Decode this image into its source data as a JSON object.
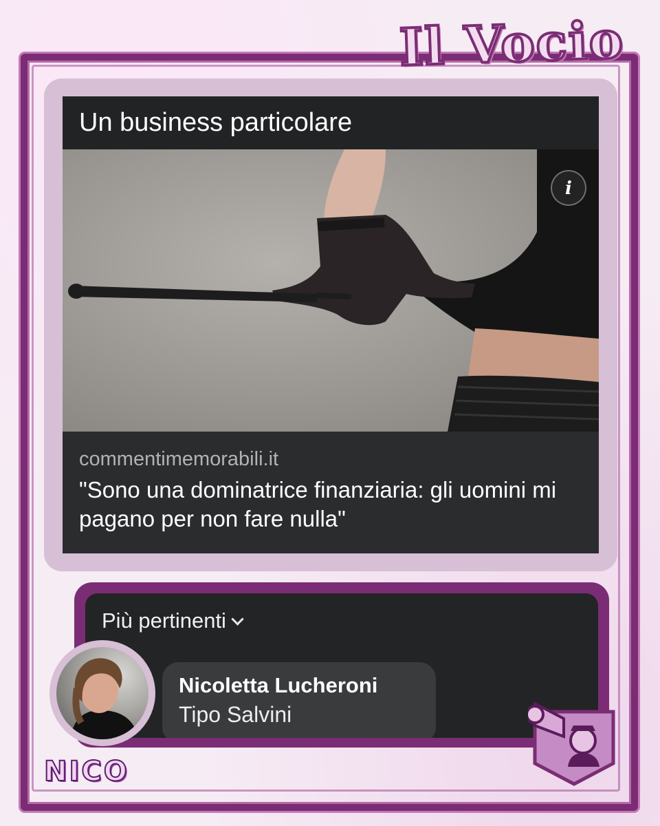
{
  "brand": {
    "title": "Il Vocio",
    "signature": "NICO"
  },
  "post": {
    "title": "Un business particolare",
    "source": "commentimemorabili.it",
    "headline": "\"Sono una dominatrice finanziaria: gli uomini mi pagano per non fare nulla\"",
    "info_icon": "info-icon"
  },
  "comments": {
    "sort_label": "Più pertinenti",
    "sort_icon": "chevron-down-icon",
    "items": [
      {
        "author": "Nicoletta Lucheroni",
        "text": "Tipo Salvini"
      }
    ]
  },
  "colors": {
    "frame": "#7a2d74",
    "card_border": "#d7bfd6",
    "card_bg": "#2b2c2e",
    "comment_bg": "#232426"
  }
}
